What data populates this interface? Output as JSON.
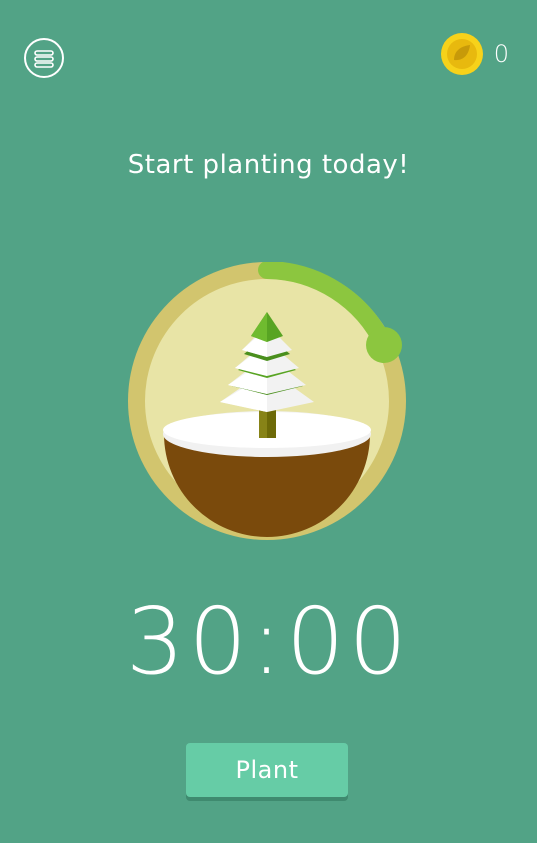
{
  "header": {
    "menu_icon": "menu-list-icon",
    "coin_icon": "coin-leaf-icon",
    "coin_count": "0"
  },
  "main": {
    "title": "Start planting today!",
    "timer": "30:00",
    "plant_button_label": "Plant",
    "tree_icon": "snowy-pine-tree-icon",
    "progress": 0.17
  },
  "colors": {
    "background": "#52a386",
    "progress_arc": "#8cc63f",
    "dial_ring": "#d2c56e",
    "dial_inner": "#e8e4a6",
    "button": "#66cca6",
    "coin": "#f7d21a"
  }
}
